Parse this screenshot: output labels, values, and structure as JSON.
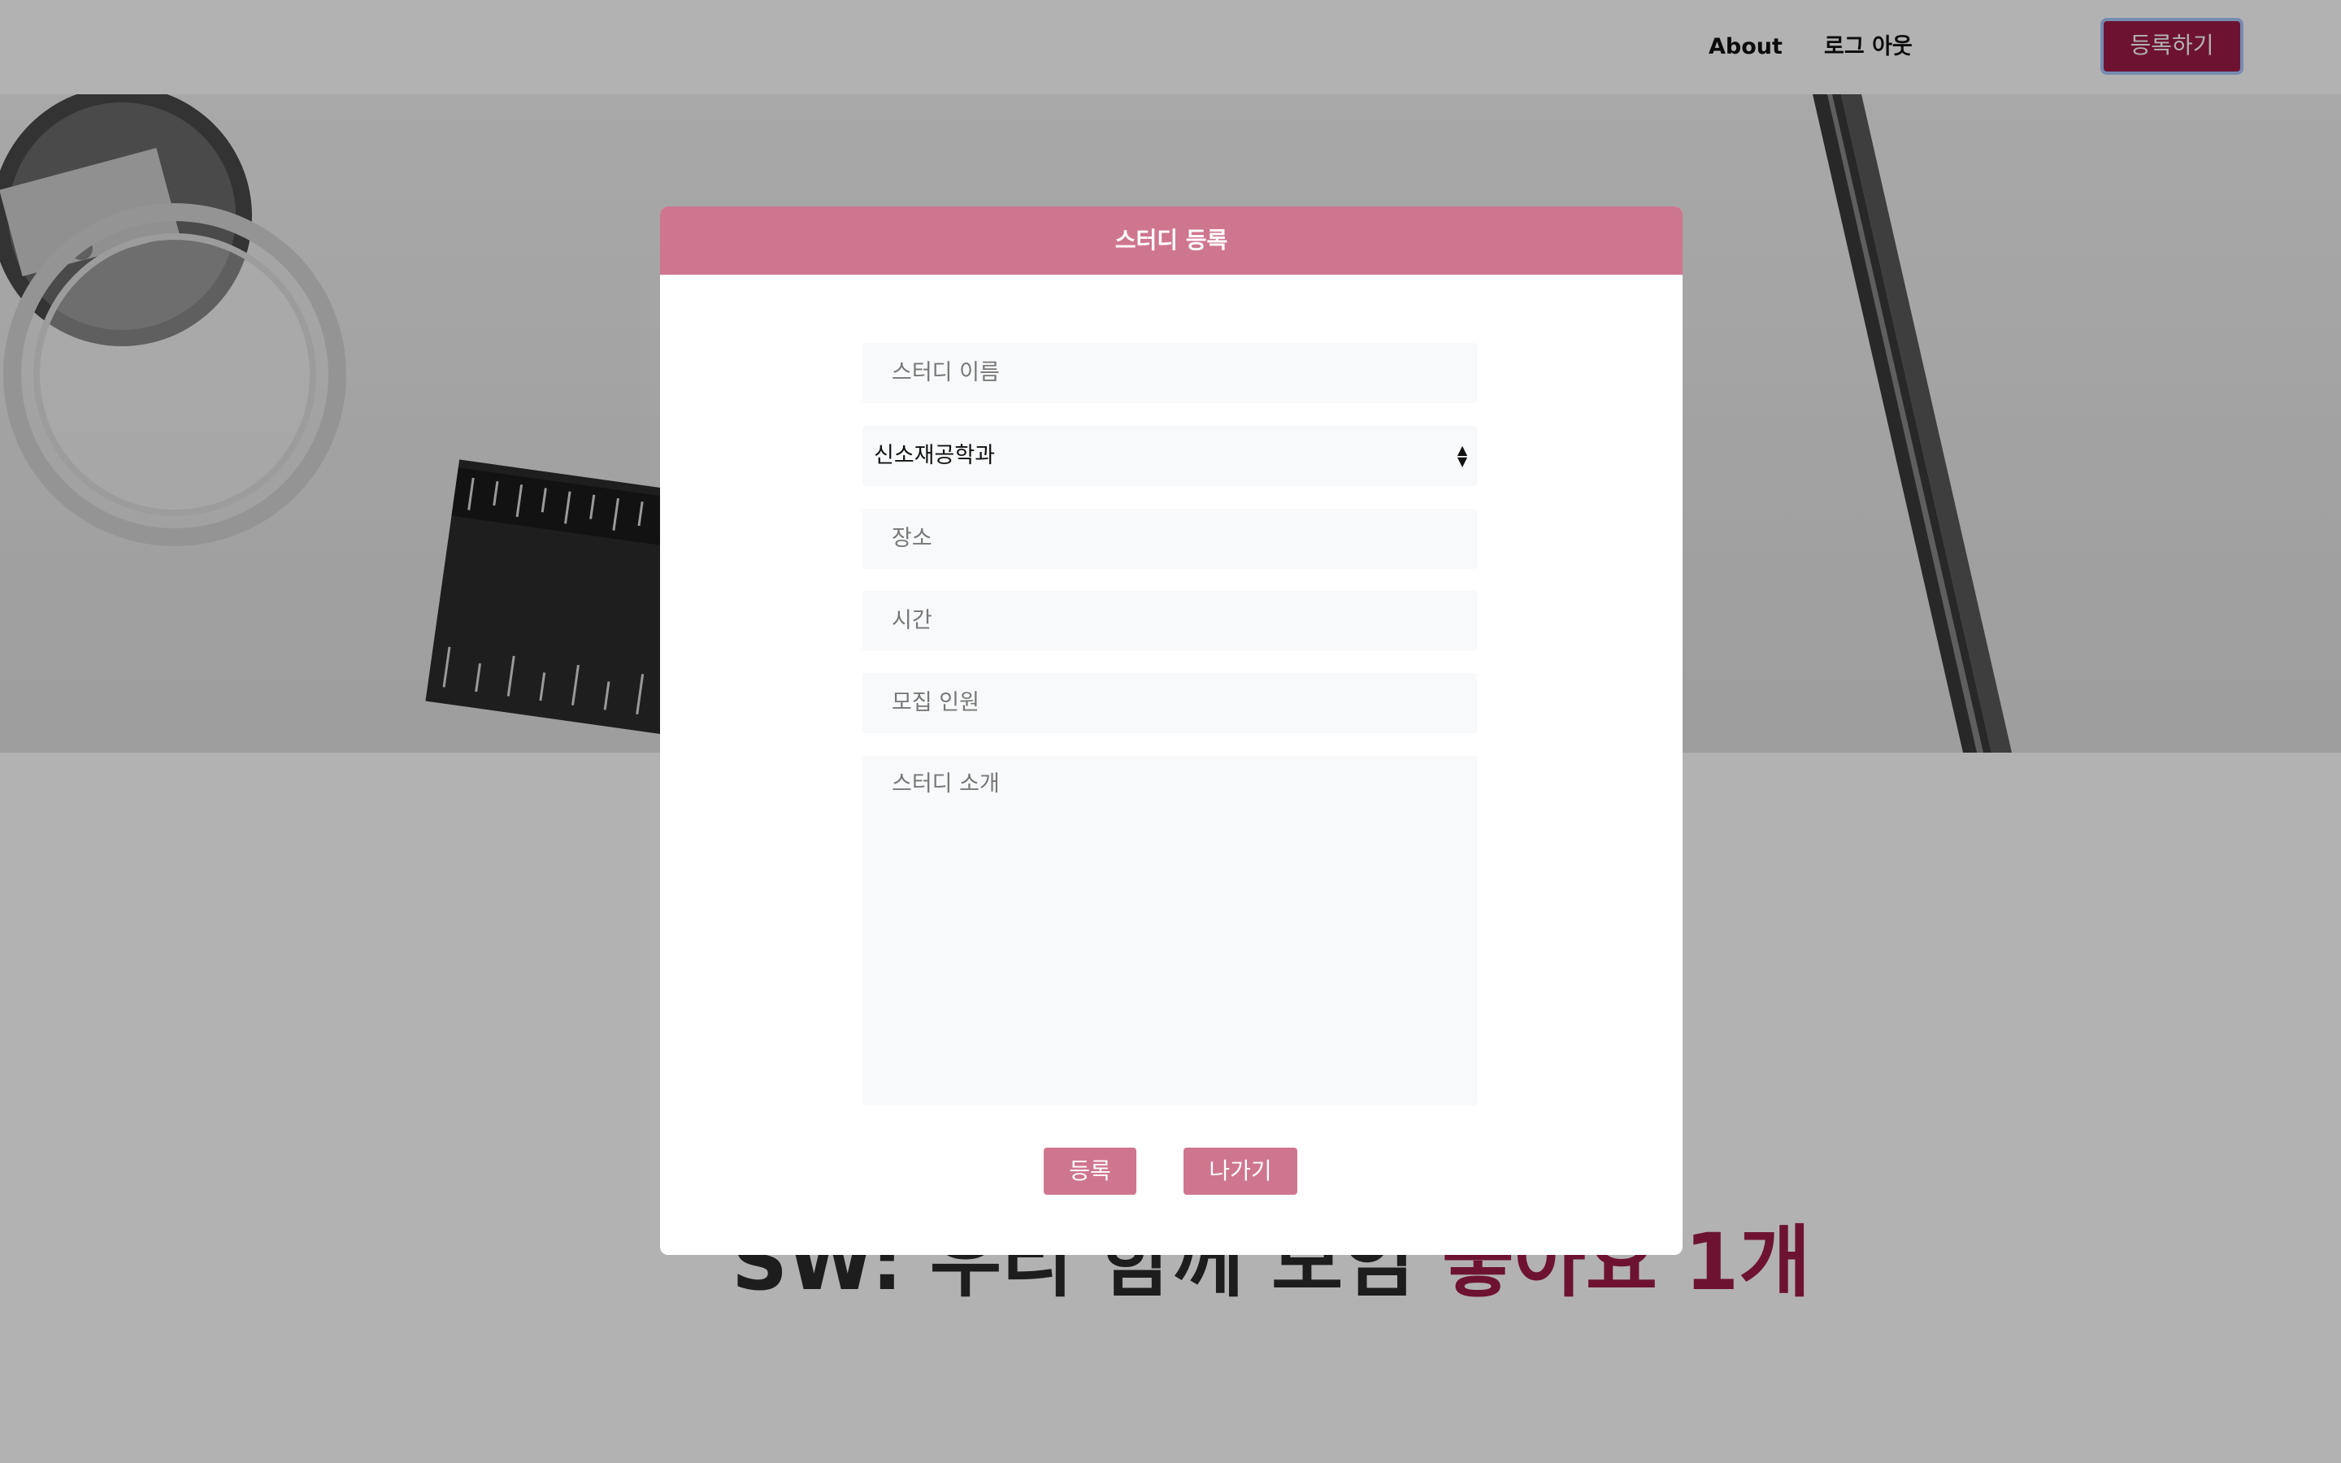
{
  "navbar": {
    "about_label": "About",
    "logout_label": "로그 아웃",
    "register_label": "등록하기"
  },
  "hero": {
    "headline_main": "SW: 우리 함께 모임",
    "headline_accent": "좋아요 1개"
  },
  "modal": {
    "title": "스터디 등록",
    "study_name_placeholder": "스터디 이름",
    "department_selected": "신소재공학과",
    "place_placeholder": "장소",
    "time_placeholder": "시간",
    "members_placeholder": "모집 인원",
    "intro_placeholder": "스터디 소개",
    "submit_label": "등록",
    "exit_label": "나가기"
  },
  "icons": {
    "select_arrow": "select-updown-icon"
  },
  "colors": {
    "accent": "#cf768f",
    "brand": "#9c1c47",
    "field_bg": "#f8f9fa"
  }
}
